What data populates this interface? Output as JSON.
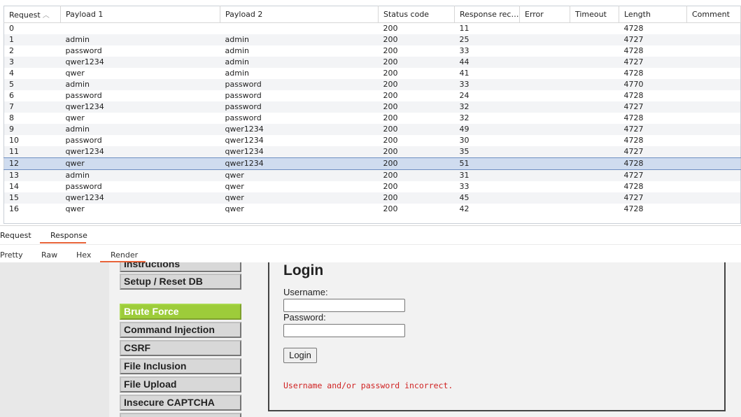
{
  "results": {
    "columns": [
      "Request",
      "Payload 1",
      "Payload 2",
      "Status code",
      "Response recei…",
      "Error",
      "Timeout",
      "Length",
      "Comment"
    ],
    "rows": [
      [
        "0",
        "",
        "",
        "200",
        "11",
        "",
        "",
        "4728",
        ""
      ],
      [
        "1",
        "admin",
        "admin",
        "200",
        "25",
        "",
        "",
        "4727",
        ""
      ],
      [
        "2",
        "password",
        "admin",
        "200",
        "33",
        "",
        "",
        "4728",
        ""
      ],
      [
        "3",
        "qwer1234",
        "admin",
        "200",
        "44",
        "",
        "",
        "4727",
        ""
      ],
      [
        "4",
        "qwer",
        "admin",
        "200",
        "41",
        "",
        "",
        "4728",
        ""
      ],
      [
        "5",
        "admin",
        "password",
        "200",
        "33",
        "",
        "",
        "4770",
        ""
      ],
      [
        "6",
        "password",
        "password",
        "200",
        "24",
        "",
        "",
        "4728",
        ""
      ],
      [
        "7",
        "qwer1234",
        "password",
        "200",
        "32",
        "",
        "",
        "4727",
        ""
      ],
      [
        "8",
        "qwer",
        "password",
        "200",
        "32",
        "",
        "",
        "4728",
        ""
      ],
      [
        "9",
        "admin",
        "qwer1234",
        "200",
        "49",
        "",
        "",
        "4727",
        ""
      ],
      [
        "10",
        "password",
        "qwer1234",
        "200",
        "30",
        "",
        "",
        "4728",
        ""
      ],
      [
        "11",
        "qwer1234",
        "qwer1234",
        "200",
        "35",
        "",
        "",
        "4727",
        ""
      ],
      [
        "12",
        "qwer",
        "qwer1234",
        "200",
        "51",
        "",
        "",
        "4728",
        ""
      ],
      [
        "13",
        "admin",
        "qwer",
        "200",
        "31",
        "",
        "",
        "4727",
        ""
      ],
      [
        "14",
        "password",
        "qwer",
        "200",
        "33",
        "",
        "",
        "4728",
        ""
      ],
      [
        "15",
        "qwer1234",
        "qwer",
        "200",
        "45",
        "",
        "",
        "4727",
        ""
      ],
      [
        "16",
        "qwer",
        "qwer",
        "200",
        "42",
        "",
        "",
        "4728",
        ""
      ]
    ],
    "selected_row": 12
  },
  "message_tabs": [
    "Request",
    "Response"
  ],
  "view_tabs": [
    "Pretty",
    "Raw",
    "Hex",
    "Render"
  ],
  "render": {
    "menu_items": [
      "Instructions",
      "Setup / Reset DB",
      "Brute Force",
      "Command Injection",
      "CSRF",
      "File Inclusion",
      "File Upload",
      "Insecure CAPTCHA"
    ],
    "active_menu": "Brute Force",
    "login_title": "Login",
    "username_label": "Username:",
    "password_label": "Password:",
    "login_button": "Login",
    "error_message": "Username and/or password incorrect."
  },
  "colors": {
    "accent_underline": "#e8643a",
    "active_menu": "#9dcc3a",
    "error_text": "#d02222",
    "selected_row": "#cfdcef"
  }
}
